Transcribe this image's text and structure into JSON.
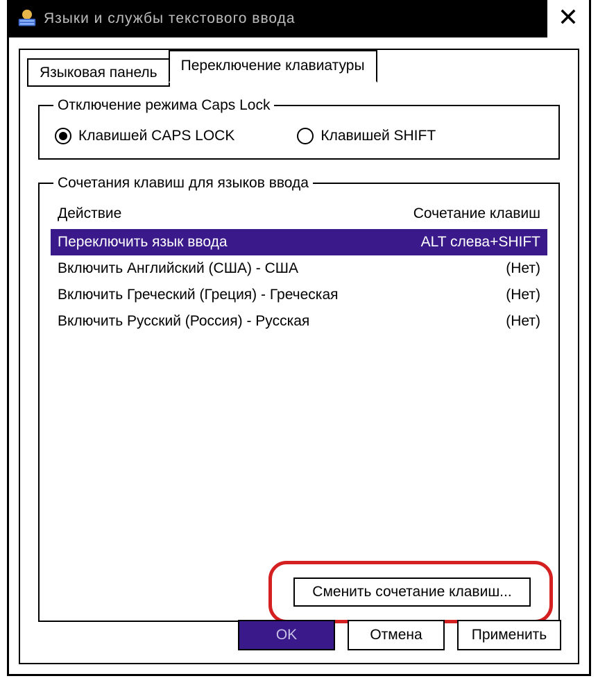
{
  "window": {
    "title": "Языки и службы текстового ввода"
  },
  "tabs": {
    "panel": "Языковая панель",
    "switch": "Переключение клавиатуры"
  },
  "caps_group": {
    "legend": "Отключение режима Caps Lock",
    "opt_caps": "Клавишей CAPS LOCK",
    "opt_shift": "Клавишей SHIFT"
  },
  "hotkeys_group": {
    "legend": "Сочетания клавиш для языков ввода",
    "col_action": "Действие",
    "col_combo": "Сочетание клавиш",
    "rows": [
      {
        "action": "Переключить язык ввода",
        "combo": "ALT слева+SHIFT"
      },
      {
        "action": "Включить Английский (США) - США",
        "combo": "(Нет)"
      },
      {
        "action": "Включить Греческий (Греция) - Греческая",
        "combo": "(Нет)"
      },
      {
        "action": "Включить Русский (Россия) - Русская",
        "combo": "(Нет)"
      }
    ],
    "change_btn": "Сменить сочетание клавиш..."
  },
  "buttons": {
    "ok": "OK",
    "cancel": "Отмена",
    "apply": "Применить"
  }
}
